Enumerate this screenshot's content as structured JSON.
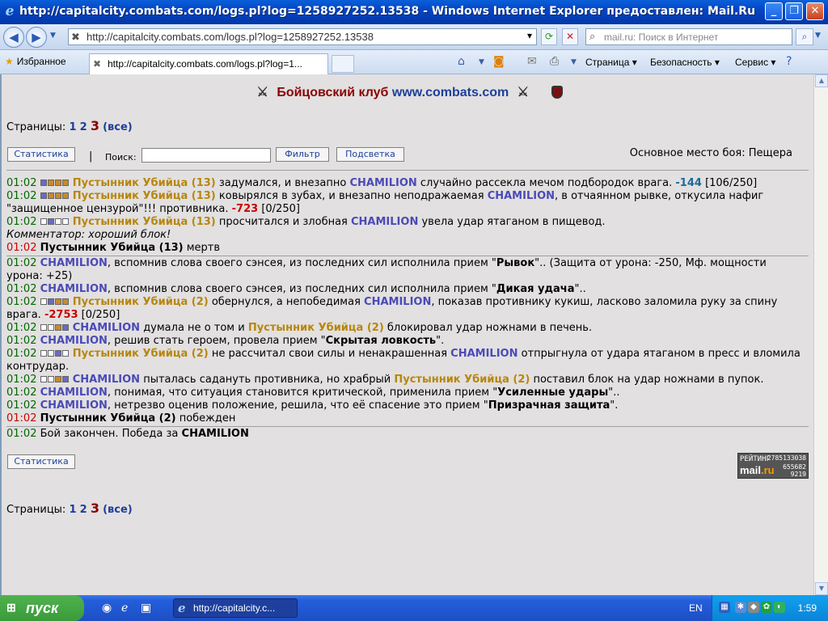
{
  "window": {
    "title": "http://capitalcity.combats.com/logs.pl?log=1258927252.13538 - Windows Internet Explorer предоставлен: Mail.Ru",
    "btn_min": "_",
    "btn_max": "❐",
    "btn_close": "✕"
  },
  "address": {
    "url": "http://capitalcity.combats.com/logs.pl?log=1258927252.13538",
    "search_placeholder": "mail.ru: Поиск в Интернет"
  },
  "tabs": {
    "favorites": "Избранное",
    "active_tab": "http://capitalcity.combats.com/logs.pl?log=1...",
    "toolbar": [
      "Страница",
      "Безопасность",
      "Сервис"
    ]
  },
  "page": {
    "club": "Бойцовский клуб",
    "site": "www.combats.com",
    "pages_label": "Страницы:",
    "page1": "1",
    "page2": "2",
    "page3": "3",
    "all": "(все)",
    "btn_stats": "Статистика",
    "separator": "|",
    "search_label": "Поиск:",
    "btn_filter": "Фильтр",
    "btn_highlight": "Подсветка",
    "place": "Основное место боя: Пещера",
    "counter_rating": "РЕЙТИНГ",
    "counter_brand": "mail",
    "counter_brand2": ".ru",
    "counter_n1": "2785133038",
    "counter_n2": "655682",
    "counter_n3": "9219"
  },
  "log": {
    "time": "01:02",
    "l1": {
      "enemy": "Пустынник Убийца (13)",
      "t1": " задумался, и внезапно ",
      "hero": "CHAMILION",
      "t2": " случайно рассекла мечом подбородок врага. ",
      "dmg": "-144",
      "t3": " [106/250]"
    },
    "l2": {
      "enemy": "Пустынник Убийца (13)",
      "t1": " ковырялся в зубах, и внезапно неподражаемая ",
      "hero": "CHAMILION",
      "t2": ", в отчаянном рывке, откусила нафиг \"защищенное цензурой\"!!! противника. ",
      "dmg": "-723",
      "t3": " [0/250]"
    },
    "l3": {
      "enemy": "Пустынник Убийца (13)",
      "t1": " просчитался и злобная ",
      "hero": "CHAMILION",
      "t2": " увела удар ятаганом в пищевод."
    },
    "comment": "Комментатор: хороший блок!",
    "l4": {
      "name": "Пустынник Убийца (13)",
      "t1": " мертв"
    },
    "l5": {
      "hero": "CHAMILION",
      "t1": ", вспомнив слова своего сэнсея, из последних сил исполнила прием \"",
      "skill": "Рывок",
      "t2": "\".. (Защита от урона: -250, Мф. мощности урона: +25)"
    },
    "l6": {
      "hero": "CHAMILION",
      "t1": ", вспомнив слова своего сэнсея, из последних сил исполнила прием \"",
      "skill": "Дикая удача",
      "t2": "\".."
    },
    "l7": {
      "enemy": "Пустынник Убийца (2)",
      "t1": " обернулся, а непобедимая ",
      "hero": "CHAMILION",
      "t2": ", показав противнику кукиш, ласково заломила руку за спину врага. ",
      "dmg": "-2753",
      "t3": " [0/250]"
    },
    "l8": {
      "hero": "CHAMILION",
      "t1": " думала не о том и ",
      "enemy": "Пустынник Убийца (2)",
      "t2": " блокировал удар ножнами в печень."
    },
    "l9": {
      "hero": "CHAMILION",
      "t1": ", решив стать героем, провела прием \"",
      "skill": "Скрытая ловкость",
      "t2": "\"."
    },
    "l10": {
      "enemy": "Пустынник Убийца (2)",
      "t1": " не рассчитал свои силы и ненакрашенная ",
      "hero": "CHAMILION",
      "t2": " отпрыгнула от удара ятаганом в пресс и вломила контрудар."
    },
    "l11": {
      "hero": "CHAMILION",
      "t1": " пыталась садануть противника, но храбрый ",
      "enemy": "Пустынник Убийца (2)",
      "t2": " поставил блок на удар ножнами в пупок."
    },
    "l12": {
      "hero": "CHAMILION",
      "t1": ", понимая, что ситуация становится критической, применила прием \"",
      "skill": "Усиленные удары",
      "t2": "\".."
    },
    "l13": {
      "hero": "CHAMILION",
      "t1": ", нетрезво оценив положение, решила, что её спасение это прием \"",
      "skill": "Призрачная защита",
      "t2": "\"."
    },
    "l14": {
      "name": "Пустынник Убийца (2)",
      "t1": " побежден"
    },
    "l15": {
      "t1": "Бой закончен. Победа за ",
      "hero": "CHAMILION"
    }
  },
  "taskbar": {
    "start": "пуск",
    "task": "http://capitalcity.c...",
    "lang": "EN",
    "clock": "1:59"
  }
}
